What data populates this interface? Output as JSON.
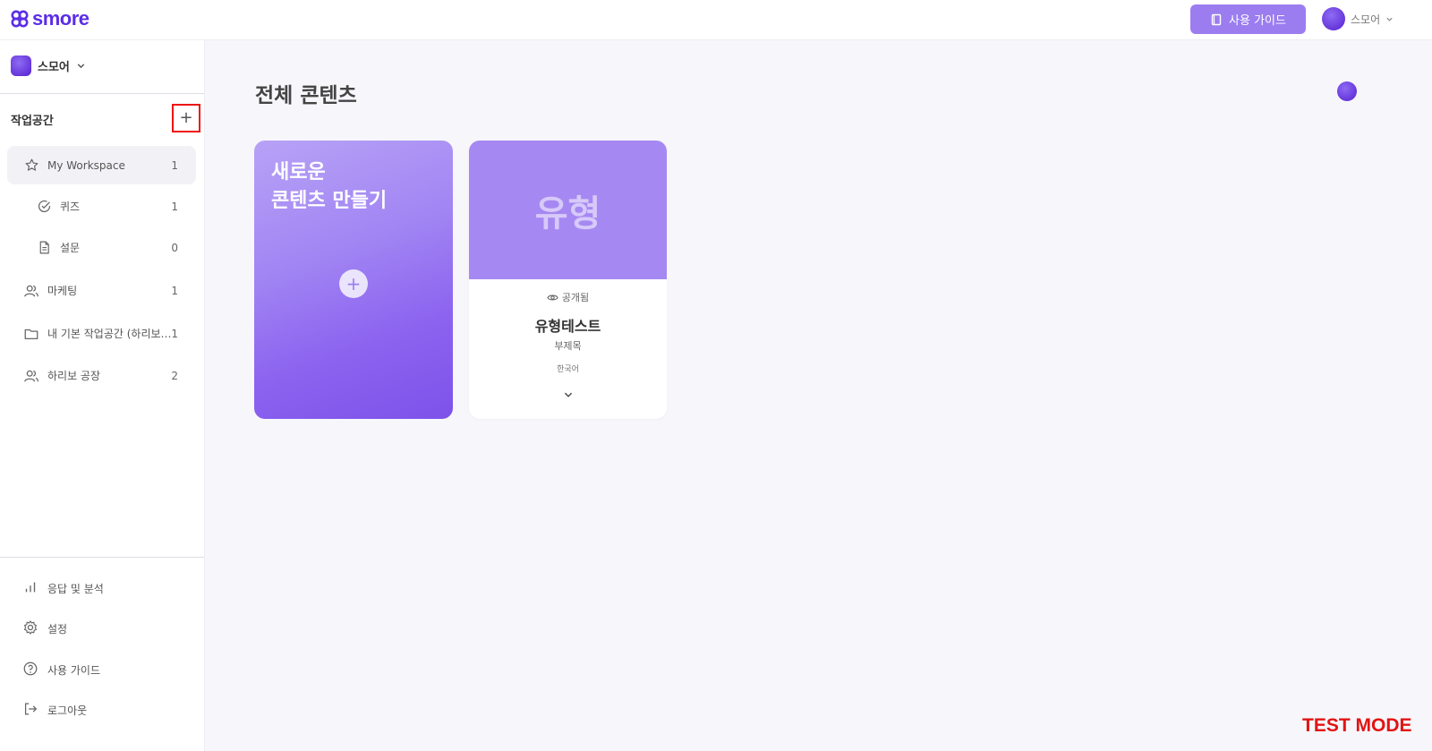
{
  "header": {
    "logo_text": "smore",
    "guide_button_label": "사용 가이드",
    "user_name": "스모어"
  },
  "sidebar": {
    "space_name": "스모어",
    "section_title": "작업공간",
    "add_label": "+",
    "items": [
      {
        "label": "My Workspace",
        "count": "1",
        "icon": "star-icon"
      },
      {
        "label": "퀴즈",
        "count": "1",
        "icon": "check-circle-icon"
      },
      {
        "label": "설문",
        "count": "0",
        "icon": "document-icon"
      },
      {
        "label": "마케팅",
        "count": "1",
        "icon": "users-icon"
      },
      {
        "label": "내 기본 작업공간 (하리보'…",
        "count": "1",
        "icon": "folder-icon"
      },
      {
        "label": "하리보 공장",
        "count": "2",
        "icon": "users-icon"
      }
    ],
    "bottom_items": [
      {
        "label": "응답 및 분석",
        "icon": "bar-chart-icon"
      },
      {
        "label": "설정",
        "icon": "gear-icon"
      },
      {
        "label": "사용 가이드",
        "icon": "help-circle-icon"
      },
      {
        "label": "로그아웃",
        "icon": "logout-icon"
      }
    ]
  },
  "main": {
    "title": "전체 콘텐츠",
    "new_card": {
      "line1": "새로운",
      "line2": "콘텐츠 만들기",
      "plus": "+"
    },
    "content_card": {
      "thumb_text": "유형",
      "visibility": "공개됨",
      "title": "유형테스트",
      "subtitle": "부제목",
      "language": "한국어"
    }
  },
  "watermark": "TEST MODE",
  "colors": {
    "brand": "#5b2ee6",
    "accent": "#9b7df0",
    "highlight_border": "#e11111",
    "test_mode": "#e21414"
  }
}
